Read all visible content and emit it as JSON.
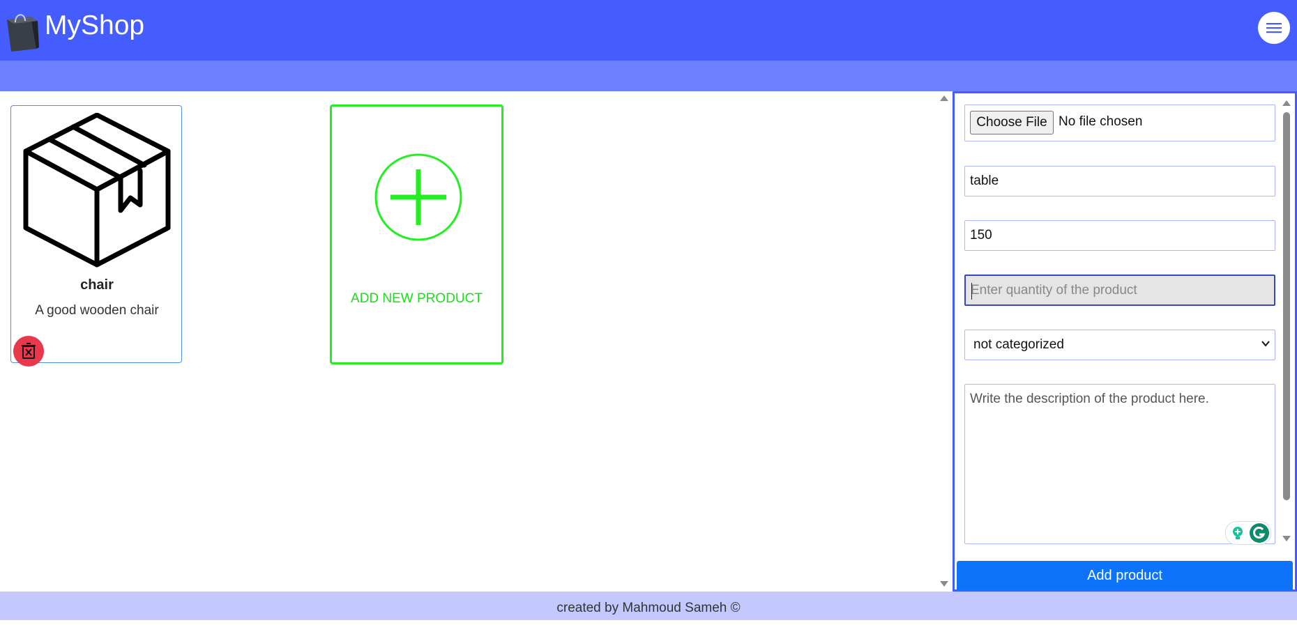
{
  "header": {
    "brand": "MyShop",
    "logo_icon": "shopping-bag-icon",
    "menu_icon": "hamburger-menu-icon",
    "color": "#455dff",
    "subbar_color": "#6e80ff"
  },
  "products": [
    {
      "icon": "box-icon",
      "name": "chair",
      "description": "A good wooden chair",
      "delete_icon": "trash-icon"
    }
  ],
  "add_card": {
    "label": "ADD NEW PRODUCT",
    "icon": "plus-circle-icon",
    "color": "#22ee22"
  },
  "form": {
    "file_button": "Choose File",
    "file_status": "No file chosen",
    "name_value": "table",
    "price_value": "150",
    "quantity_placeholder": "Enter quantity of the product",
    "category_selected": "not categorized",
    "description_placeholder": "Write the description of the product here.",
    "submit_label": "Add product",
    "submit_color": "#0d73fb"
  },
  "footer": {
    "text": "created by Mahmoud Sameh ©"
  }
}
